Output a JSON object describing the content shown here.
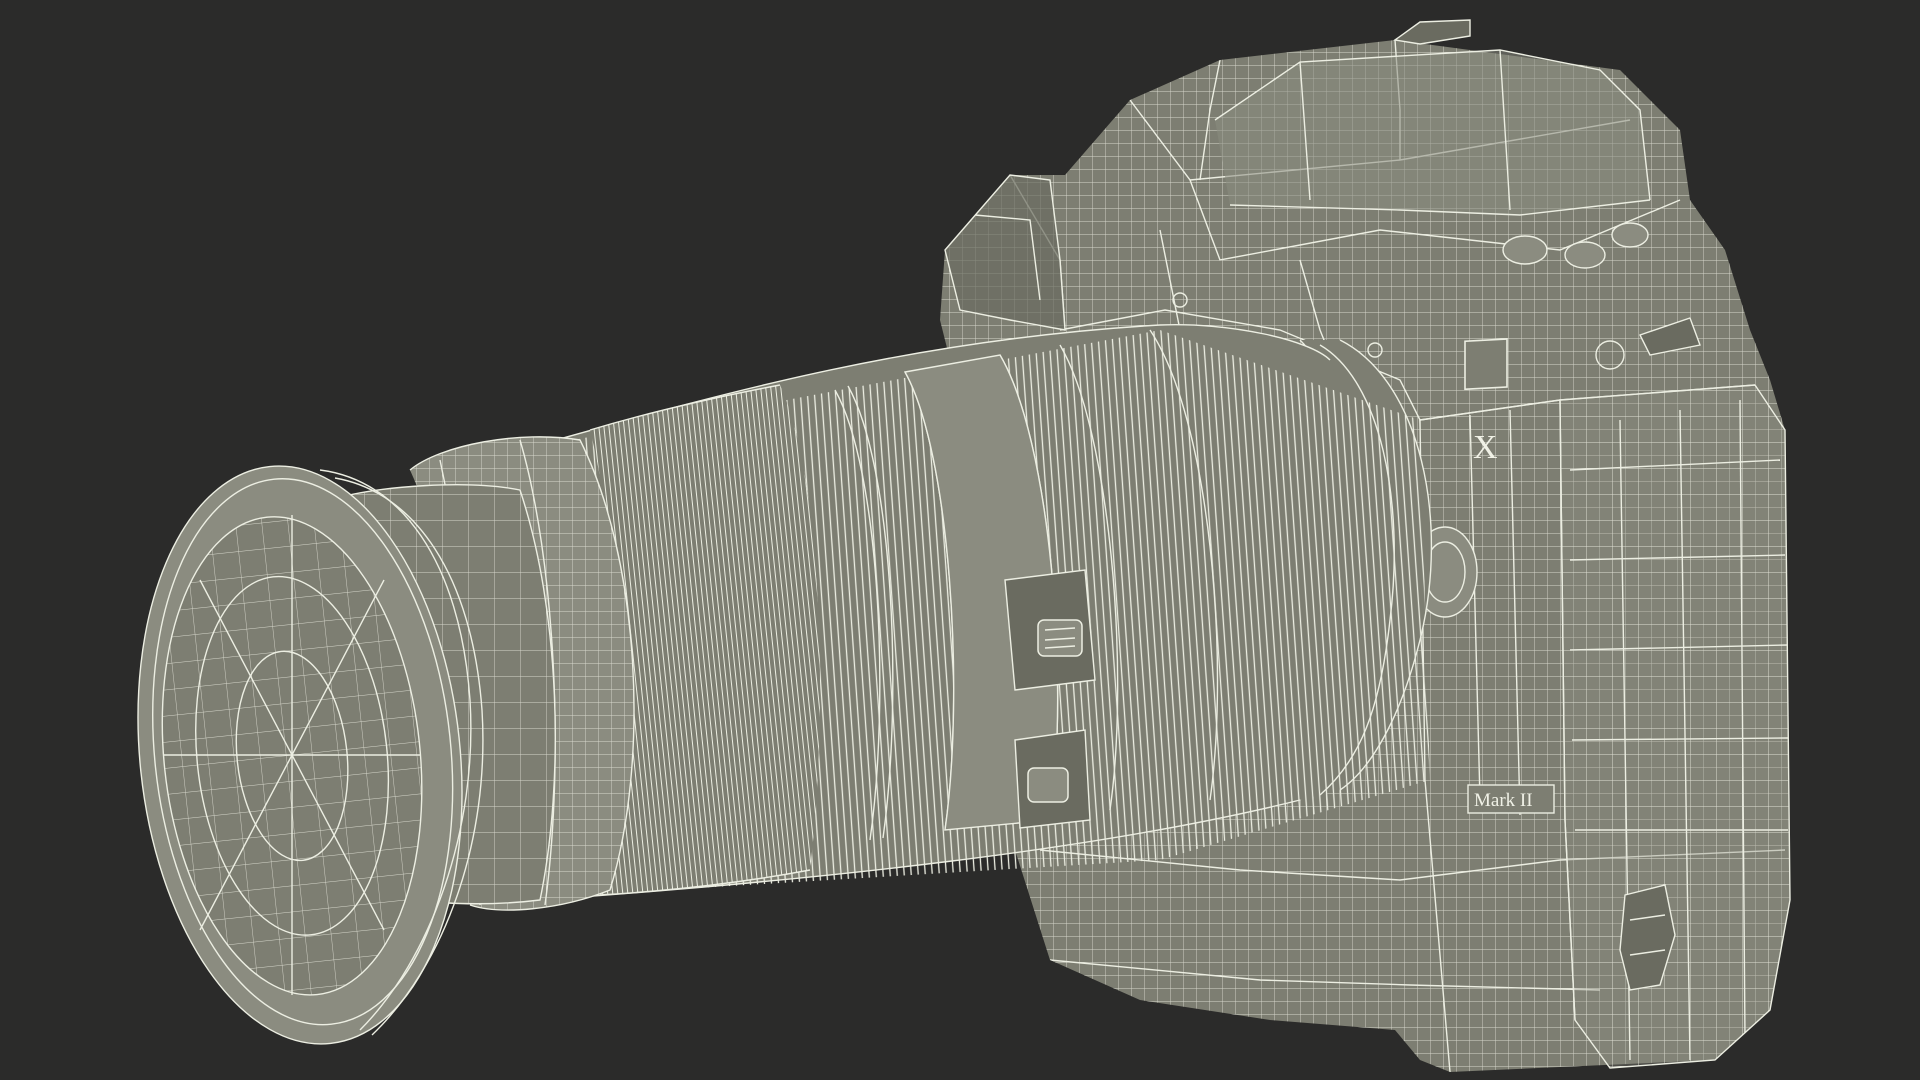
{
  "scene": {
    "background": "#2b2b2a",
    "mesh_fill": "#7d7e72",
    "wire_color": "#eceee2"
  },
  "camera": {
    "badge_letter": "X",
    "model_label": "Mark II"
  }
}
